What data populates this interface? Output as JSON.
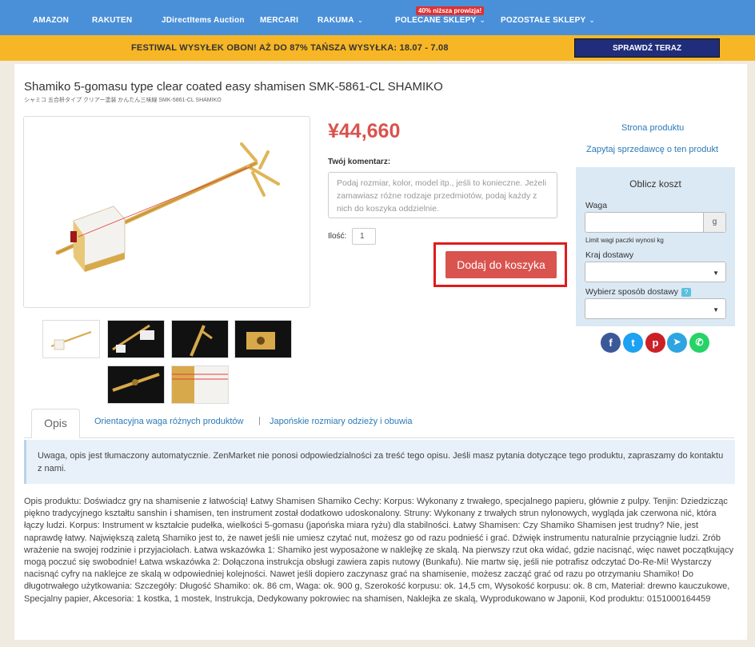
{
  "nav": {
    "items": [
      {
        "label": "AMAZON",
        "has_dropdown": false
      },
      {
        "label": "RAKUTEN",
        "has_dropdown": false
      },
      {
        "label": "JDirectItems Auction",
        "has_dropdown": false
      },
      {
        "label": "MERCARI",
        "has_dropdown": false
      },
      {
        "label": "RAKUMA",
        "has_dropdown": true
      },
      {
        "label": "POLECANE SKLEPY",
        "has_dropdown": true
      },
      {
        "label": "POZOSTAŁE SKLEPY",
        "has_dropdown": true
      }
    ],
    "badge": "40% niższa prowizja!",
    "chevron": "⌄"
  },
  "promo": {
    "text": "FESTIWAL WYSYŁEK OBON! AŻ DO 87% TAŃSZA WYSYŁKA: 18.07 - 7.08",
    "button": "SPRAWDŹ TERAZ"
  },
  "product": {
    "title": "Shamiko 5-gomasu type clear coated easy shamisen SMK-5861-CL SHAMIKO",
    "subtitle": "シャミコ 五合枡タイプ クリアー塗装 かんたん三味線 SMK-5861-CL SHAMIKO",
    "price": "¥44,660",
    "comment_label": "Twój komentarz:",
    "comment_placeholder": "Podaj rozmiar, kolor, model itp., jeśli to konieczne. Jeżeli zamawiasz różne rodzaje przedmiotów, podaj każdy z nich do koszyka oddzielnie.",
    "qty_label": "Ilość:",
    "qty_value": "1",
    "add_to_cart": "Dodaj do koszyka"
  },
  "links": {
    "product_page": "Strona produktu",
    "ask_seller": "Zapytaj sprzedawcę o ten produkt"
  },
  "calculator": {
    "title": "Oblicz koszt",
    "weight_label": "Waga",
    "weight_unit": "g",
    "weight_hint": "Limit wagi paczki wynosi kg",
    "country_label": "Kraj dostawy",
    "shipping_label": "Wybierz sposób dostawy",
    "help_icon": "?"
  },
  "social": [
    {
      "name": "facebook-icon",
      "glyph": "f",
      "color": "#3b5998"
    },
    {
      "name": "twitter-icon",
      "glyph": "t",
      "color": "#1da1f2"
    },
    {
      "name": "pinterest-icon",
      "glyph": "p",
      "color": "#cb2027"
    },
    {
      "name": "telegram-icon",
      "glyph": "➤",
      "color": "#2ca5e0"
    },
    {
      "name": "whatsapp-icon",
      "glyph": "✆",
      "color": "#25d366"
    }
  ],
  "tabs": {
    "active": "Opis",
    "weights": "Orientacyjna waga różnych produktów",
    "separator": "|",
    "sizes": "Japońskie rozmiary odzieży i obuwia"
  },
  "notice": "Uwaga, opis jest tłumaczony automatycznie. ZenMarket nie ponosi odpowiedzialności za treść tego opisu. Jeśli masz pytania dotyczące tego produktu, zapraszamy do kontaktu z nami.",
  "description": "Opis produktu: Doświadcz gry na shamisenie z łatwością! Łatwy Shamisen Shamiko Cechy: Korpus: Wykonany z trwałego, specjalnego papieru, głównie z pulpy. Tenjin: Dziedzicząc piękno tradycyjnego kształtu sanshin i shamisen, ten instrument został dodatkowo udoskonalony. Struny: Wykonany z trwałych strun nylonowych, wygląda jak czerwona nić, która łączy ludzi. Korpus: Instrument w kształcie pudełka, wielkości 5-gomasu (japońska miara ryżu) dla stabilności. Łatwy Shamisen: Czy Shamiko Shamisen jest trudny? Nie, jest naprawdę łatwy. Największą zaletą Shamiko jest to, że nawet jeśli nie umiesz czytać nut, możesz go od razu podnieść i grać. Dźwięk instrumentu naturalnie przyciągnie ludzi. Zrób wrażenie na swojej rodzinie i przyjaciołach. Łatwa wskazówka 1: Shamiko jest wyposażone w naklejkę ze skalą. Na pierwszy rzut oka widać, gdzie nacisnąć, więc nawet początkujący mogą poczuć się swobodnie! Łatwa wskazówka 2: Dołączona instrukcja obsługi zawiera zapis nutowy (Bunkafu). Nie martw się, jeśli nie potrafisz odczytać Do-Re-Mi! Wystarczy nacisnąć cyfry na naklejce ze skalą w odpowiedniej kolejności. Nawet jeśli dopiero zaczynasz grać na shamisenie, możesz zacząć grać od razu po otrzymaniu Shamiko! Do długotrwałego użytkowania: Szczegóły: Długość Shamiko: ok. 86 cm, Waga: ok. 900 g, Szerokość korpusu: ok. 14,5 cm, Wysokość korpusu: ok. 8 cm, Materiał: drewno kauczukowe, Specjalny papier, Akcesoria: 1 kostka, 1 mostek, Instrukcja, Dedykowany pokrowiec na shamisen, Naklejka ze skalą, Wyprodukowano w Japonii, Kod produktu: 0151000164459",
  "colors": {
    "nav_bg": "#4a90d9",
    "promo_bg": "#f7b625",
    "promo_button": "#1f2d7a",
    "price": "#d9534f",
    "add_button": "#d9534f",
    "highlight": "#e01b1b",
    "link": "#2a7ab7",
    "calc_bg": "#dbe9f4"
  }
}
